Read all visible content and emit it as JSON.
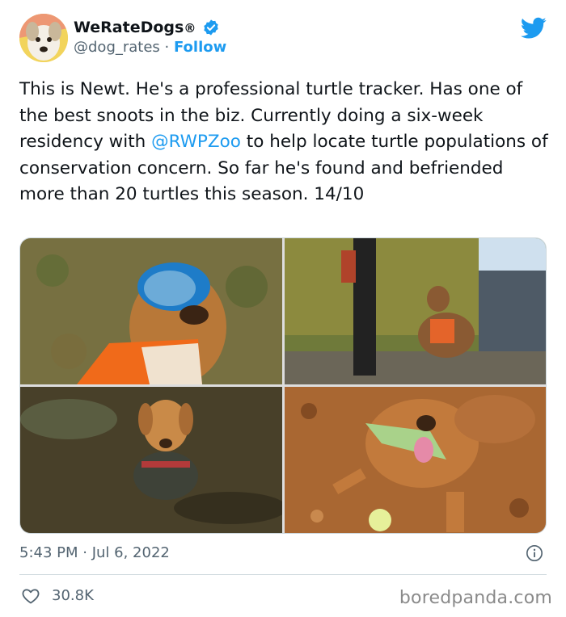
{
  "account": {
    "display_name": "WeRateDogs",
    "registered_mark": "®",
    "handle": "@dog_rates",
    "separator": " · ",
    "follow_label": "Follow"
  },
  "tweet": {
    "text_before": "This is Newt. He's a professional turtle tracker. Has one of the best snoots in the biz. Currently doing a six-week residency with ",
    "mention": "@RWPZoo",
    "text_after": " to help locate turtle populations of conservation concern. So far he's found and befriended more than 20 turtles this season. 14/10",
    "time": "5:43 PM",
    "date": "Jul 6, 2022",
    "likes": "30.8K"
  },
  "icons": {
    "verified": "verified-badge-icon",
    "logo": "twitter-bird-icon",
    "info": "info-icon",
    "like": "heart-icon"
  },
  "colors": {
    "accent": "#1d9bf0",
    "text": "#0f1419",
    "muted": "#536471"
  },
  "watermark": "boredpanda.com"
}
